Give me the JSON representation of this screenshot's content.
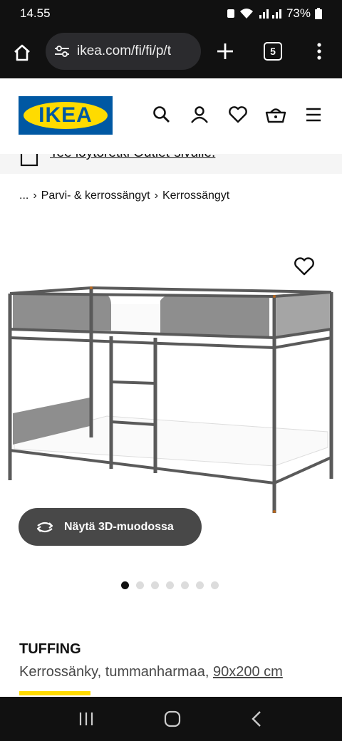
{
  "status_bar": {
    "time": "14.55",
    "battery": "73%"
  },
  "browser": {
    "url": "ikea.com/fi/fi/p/t",
    "tab_count": "5"
  },
  "header": {
    "logo_text": "IKEA"
  },
  "promo": {
    "text": "Tee löytöretki Outlet-sivulle."
  },
  "breadcrumb": {
    "ellipsis": "...",
    "items": [
      "Parvi- & kerrossängyt",
      "Kerrossängyt"
    ]
  },
  "gallery": {
    "button_3d_label": "Näytä 3D-muodossa",
    "image_count": 7,
    "active_index": 0
  },
  "product": {
    "name": "TUFFING",
    "description": "Kerrossänky, tummanharmaa,",
    "size": "90x200 cm"
  },
  "colors": {
    "ikea_blue": "#0058a3",
    "ikea_yellow": "#ffdb00"
  }
}
